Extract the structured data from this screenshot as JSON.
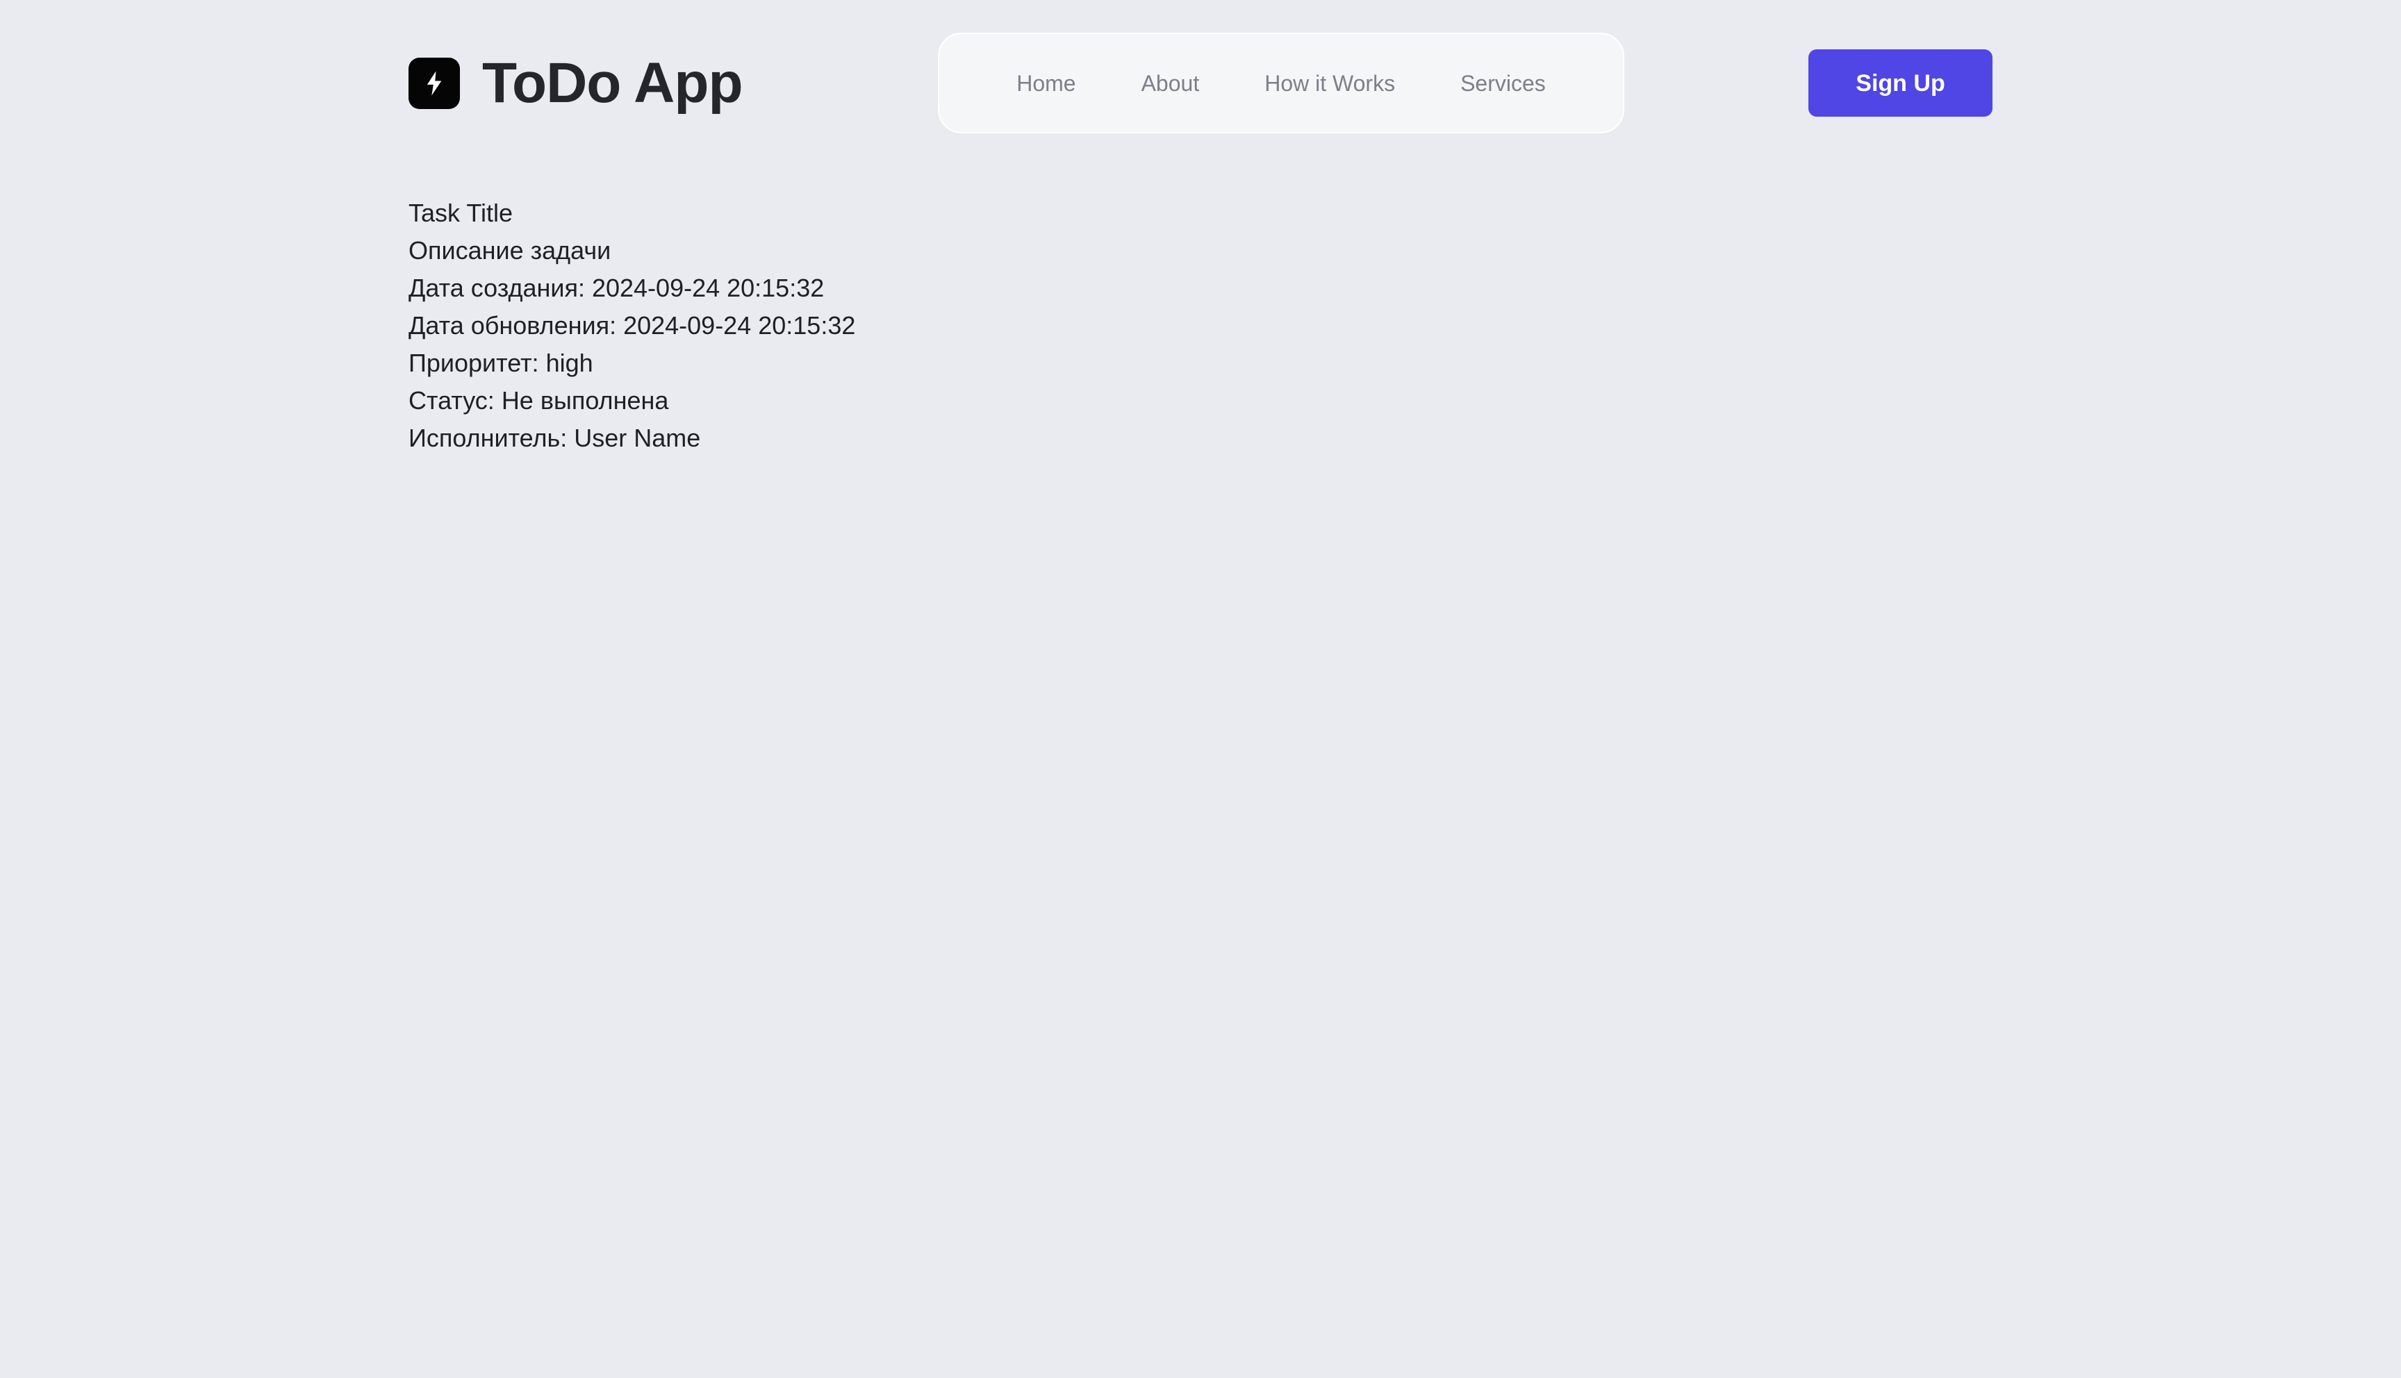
{
  "app": {
    "title": "ToDo App",
    "logo_icon": "lightning-bolt-icon"
  },
  "nav": {
    "items": [
      {
        "label": "Home"
      },
      {
        "label": "About"
      },
      {
        "label": "How it Works"
      },
      {
        "label": "Services"
      }
    ]
  },
  "header": {
    "signup_label": "Sign Up"
  },
  "colors": {
    "background": "#e9ebf0",
    "nav_background": "#f5f6f8",
    "primary": "#4f46e5",
    "text": "#1f2025",
    "nav_text": "#7d7f8a"
  },
  "task": {
    "title": "Task Title",
    "description": "Описание задачи",
    "created_label": "Дата создания:",
    "created_value": "2024-09-24 20:15:32",
    "updated_label": "Дата обновления:",
    "updated_value": "2024-09-24 20:15:32",
    "priority_label": "Приоритет:",
    "priority_value": "high",
    "status_label": "Статус:",
    "status_value": "Не выполнена",
    "assignee_label": "Исполнитель:",
    "assignee_value": "User Name"
  }
}
